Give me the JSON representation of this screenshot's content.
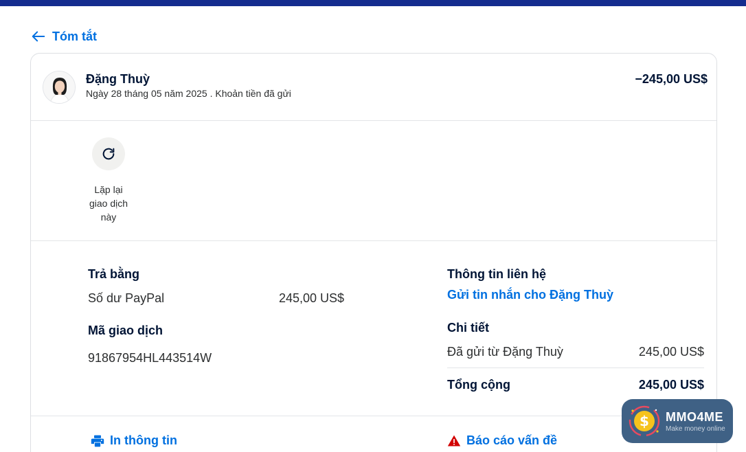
{
  "nav": {
    "back_label": "Tóm tắt"
  },
  "transaction": {
    "name": "Đặng Thuỳ",
    "subline": "Ngày 28 tháng 05 năm 2025 . Khoản tiền đã gửi",
    "amount": "−245,00 US$"
  },
  "actions": {
    "repeat_label": "Lặp lại giao dịch này"
  },
  "payment": {
    "heading": "Trả bằng",
    "method": "Số dư PayPal",
    "method_amount": "245,00 US$",
    "txn_id_heading": "Mã giao dịch",
    "txn_id": "91867954HL443514W"
  },
  "contact": {
    "heading": "Thông tin liên hệ",
    "message_link": "Gửi tin nhắn cho Đặng Thuỳ"
  },
  "detail": {
    "heading": "Chi tiết",
    "sent_from_label": "Đã gửi từ Đặng Thuỳ",
    "sent_from_amount": "245,00 US$",
    "total_label": "Tổng cộng",
    "total_amount": "245,00 US$"
  },
  "footer": {
    "print_label": "In thông tin",
    "report_label": "Báo cáo vấn đề"
  },
  "watermark": {
    "title": "MMO4ME",
    "subtitle": "Make money online"
  },
  "colors": {
    "link": "#0070e0",
    "topbar": "#142c8e",
    "text": "#001435",
    "warning": "#d20000"
  }
}
